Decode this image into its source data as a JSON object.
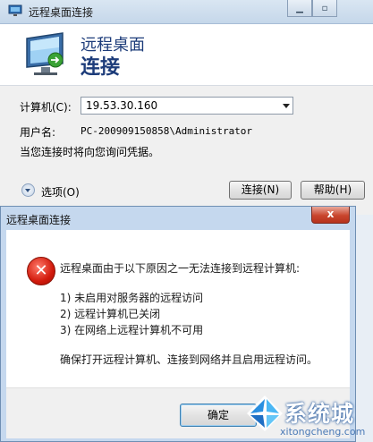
{
  "rdc_window": {
    "title": "远程桌面连接",
    "header_line1": "远程桌面",
    "header_line2": "连接",
    "computer_label": "计算机(C):",
    "computer_value": "19.53.30.160",
    "username_label": "用户名:",
    "username_value": "PC-200909150858\\Administrator",
    "credential_note": "当您连接时将向您询问凭据。",
    "options_label": "选项(O)",
    "connect_button": "连接(N)",
    "help_button": "帮助(H)",
    "icons": [
      "rdc-app-icon",
      "monitor-icon",
      "minimize-icon",
      "maximize-icon",
      "dropdown-arrow-icon",
      "options-expand-icon"
    ]
  },
  "error_dialog": {
    "title": "远程桌面连接",
    "close_glyph": "x",
    "icon": "error-icon",
    "message": "远程桌面由于以下原因之一无法连接到远程计算机:",
    "reasons": [
      "1) 未启用对服务器的远程访问",
      "2) 远程计算机已关闭",
      "3) 在网络上远程计算机不可用"
    ],
    "advice": "确保打开远程计算机、连接到网络并且启用远程访问。",
    "ok_button": "确定"
  },
  "watermark": {
    "brand": "系统城",
    "url": "xitongcheng.com"
  }
}
